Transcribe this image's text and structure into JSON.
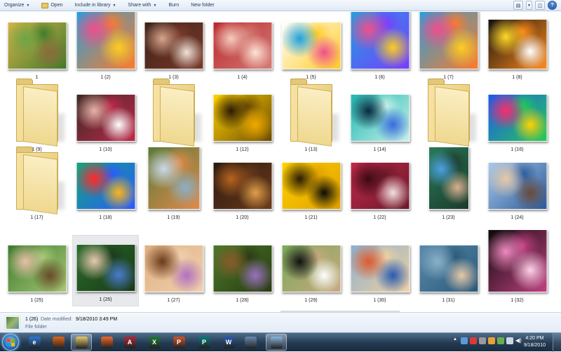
{
  "toolbar": {
    "organize": "Organize",
    "open": "Open",
    "include_in_library": "Include in library",
    "share_with": "Share with",
    "burn": "Burn",
    "new_folder": "New folder"
  },
  "items": [
    {
      "label": "1",
      "kind": "photo",
      "colors": [
        "#d6b34a",
        "#6ea545",
        "#8a6a3c",
        "#3f7a2a"
      ]
    },
    {
      "label": "1 (2)",
      "kind": "photo",
      "colors": [
        "#1da2e0",
        "#f04f8a",
        "#ffcc22",
        "#ff7a2a"
      ]
    },
    {
      "label": "1 (3)",
      "kind": "photo",
      "colors": [
        "#3b2218",
        "#d9a48c",
        "#f2e2d8",
        "#7a3a2a"
      ]
    },
    {
      "label": "1 (4)",
      "kind": "photo",
      "colors": [
        "#b9282e",
        "#f4cdbd",
        "#ffe3d6",
        "#d37b74"
      ]
    },
    {
      "label": "1 (5)",
      "kind": "photo",
      "colors": [
        "#ffffff",
        "#1da2e0",
        "#f04f8a",
        "#ffcc22"
      ]
    },
    {
      "label": "1 (6)",
      "kind": "photo",
      "colors": [
        "#1da2e0",
        "#f04f8a",
        "#ffcc22",
        "#7a3cff"
      ]
    },
    {
      "label": "1 (7)",
      "kind": "photo",
      "colors": [
        "#1da2e0",
        "#f04f8a",
        "#ffcc22",
        "#ff7a2a"
      ]
    },
    {
      "label": "1 (8)",
      "kind": "photo",
      "colors": [
        "#111111",
        "#ffd928",
        "#ffffff",
        "#ff8a1a"
      ]
    },
    {
      "label": "1 (9)",
      "kind": "folder"
    },
    {
      "label": "1 (10)",
      "kind": "photo",
      "colors": [
        "#3a2a25",
        "#e7b3a8",
        "#ffffff",
        "#c0284a"
      ]
    },
    {
      "label": "1 (11)",
      "kind": "folder"
    },
    {
      "label": "1 (12)",
      "kind": "photo",
      "colors": [
        "#ffd300",
        "#2a1a05",
        "#f0a800",
        "#6a4a05"
      ]
    },
    {
      "label": "1 (13)",
      "kind": "folder"
    },
    {
      "label": "1 (14)",
      "kind": "photo",
      "colors": [
        "#1fb8b0",
        "#0a2a40",
        "#3a6adf",
        "#c8f0ea"
      ]
    },
    {
      "label": "1 (15)",
      "kind": "folder"
    },
    {
      "label": "1 (16)",
      "kind": "photo",
      "colors": [
        "#2255ee",
        "#ff2a6a",
        "#ffd300",
        "#22cc55"
      ]
    },
    {
      "label": "1 (17)",
      "kind": "folder"
    },
    {
      "label": "1 (18)",
      "kind": "photo",
      "colors": [
        "#13a67a",
        "#ff2a2a",
        "#ffb41a",
        "#2a5aff"
      ]
    },
    {
      "label": "1 (19)",
      "kind": "photo",
      "colors": [
        "#5a7a3a",
        "#c9d9e9",
        "#8ab0c8",
        "#e08a4a"
      ]
    },
    {
      "label": "1 (20)",
      "kind": "photo",
      "colors": [
        "#2a1a12",
        "#b7641e",
        "#e0a04a",
        "#6a3a1a"
      ]
    },
    {
      "label": "1 (21)",
      "kind": "photo",
      "colors": [
        "#ffd200",
        "#2a1a05",
        "#0a0a08",
        "#e0a000"
      ]
    },
    {
      "label": "1 (22)",
      "kind": "photo",
      "colors": [
        "#c0284a",
        "#3a0a12",
        "#f2e0e0",
        "#6a1a2a"
      ]
    },
    {
      "label": "1 (23)",
      "kind": "photo",
      "colors": [
        "#2a7a5a",
        "#4aa0e0",
        "#d8b090",
        "#1a3a2a"
      ]
    },
    {
      "label": "1 (24)",
      "kind": "photo",
      "colors": [
        "#a9c9e9",
        "#e8c8a8",
        "#6a4a3a",
        "#2a5a9a"
      ]
    },
    {
      "label": "1 (25)",
      "kind": "photo",
      "colors": [
        "#3a7a2a",
        "#e8c0a8",
        "#6a4a2a",
        "#a8c878"
      ]
    },
    {
      "label": "1 (26)",
      "kind": "photo",
      "colors": [
        "#2a6a2a",
        "#e8c8b0",
        "#4a7ad0",
        "#1a3a1a"
      ]
    },
    {
      "label": "1 (27)",
      "kind": "photo",
      "colors": [
        "#e0b080",
        "#6a3a1a",
        "#b070c0",
        "#f0d0b0"
      ]
    },
    {
      "label": "1 (28)",
      "kind": "photo",
      "colors": [
        "#4a7a2a",
        "#8a5a2a",
        "#9a70c0",
        "#2a3a12"
      ]
    },
    {
      "label": "1 (29)",
      "kind": "photo",
      "colors": [
        "#7aaa5a",
        "#111111",
        "#ffffff",
        "#c8a880"
      ]
    },
    {
      "label": "1 (30)",
      "kind": "photo",
      "colors": [
        "#8ab0d0",
        "#e05a2a",
        "#2a5ab0",
        "#f0d0a0"
      ]
    },
    {
      "label": "1 (31)",
      "kind": "photo",
      "colors": [
        "#5a8aaa",
        "#8ab0c8",
        "#e8c8a8",
        "#2a5a7a"
      ]
    },
    {
      "label": "1 (32)",
      "kind": "photo",
      "colors": [
        "#0a0a0a",
        "#f08ac0",
        "#ffd0e8",
        "#c04080"
      ]
    }
  ],
  "selected_index": 25,
  "details": {
    "name": "1 (26)",
    "modified_label": "Date modified:",
    "modified_value": "9/18/2010 3:49 PM",
    "type": "File folder"
  },
  "taskbar": {
    "time": "4:20 PM",
    "date": "9/18/2010",
    "apps": [
      {
        "name": "ie-icon",
        "glyph": "e",
        "color": "#2a7ad8"
      },
      {
        "name": "firefox-icon",
        "glyph": "",
        "color": "#e0661a"
      },
      {
        "name": "explorer-icon",
        "glyph": "",
        "color": "#e8c86a"
      },
      {
        "name": "photo-gallery-icon",
        "glyph": "",
        "color": "#f06a2a"
      },
      {
        "name": "access-icon",
        "glyph": "A",
        "color": "#b02a3a"
      },
      {
        "name": "excel-icon",
        "glyph": "X",
        "color": "#1e7a3a"
      },
      {
        "name": "powerpoint-icon",
        "glyph": "P",
        "color": "#d2542a"
      },
      {
        "name": "publisher-icon",
        "glyph": "P",
        "color": "#0a7a7a"
      },
      {
        "name": "word-icon",
        "glyph": "W",
        "color": "#2a5ab0"
      },
      {
        "name": "window-icon",
        "glyph": "",
        "color": "#6a8ab0"
      },
      {
        "name": "explorer-window-icon",
        "glyph": "",
        "color": "#8ab8e0"
      }
    ]
  }
}
